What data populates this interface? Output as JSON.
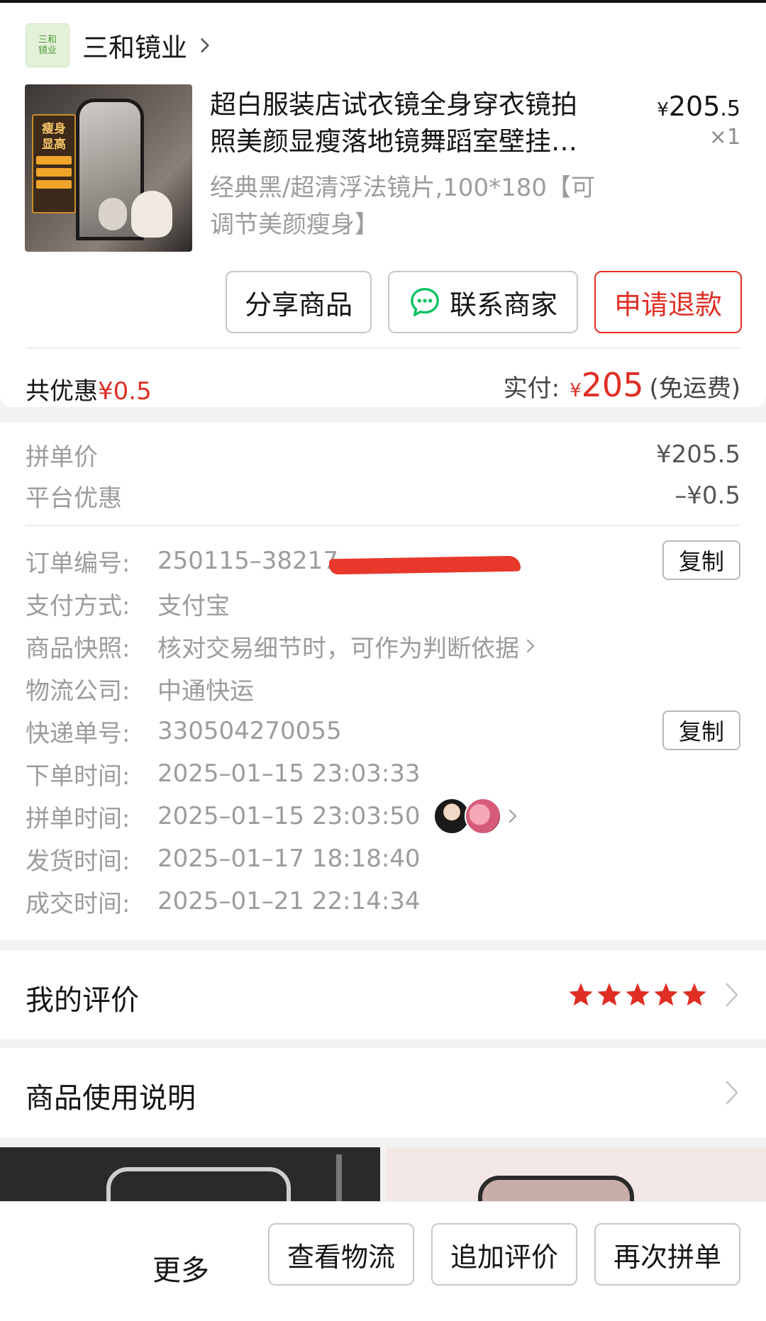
{
  "shop": {
    "name": "三和镜业",
    "logo_text": [
      "三和",
      "镜业"
    ]
  },
  "product": {
    "image_badge": "瘦身显高",
    "title_lines": [
      "超白服装店试衣镜全身穿衣镜拍",
      "照美颜显瘦落地镜舞蹈室壁挂…"
    ],
    "price_yen": "¥",
    "price_int": "205",
    "price_dec": ".5",
    "quantity": "×1",
    "spec_lines": [
      "经典黑/超清浮法镜片,100*180【可",
      "调节美颜瘦身】"
    ]
  },
  "actions": {
    "share": "分享商品",
    "contact": "联系商家",
    "refund": "申请退款"
  },
  "summary": {
    "savings_label": "共优惠",
    "savings_value": "¥0.5",
    "paid_label": "实付:",
    "paid_yen": "¥",
    "paid_amount": "205",
    "shipping": "(免运费)"
  },
  "price_breakdown": {
    "group_price_label": "拼单价",
    "group_price_value": "¥205.5",
    "platform_discount_label": "平台优惠",
    "platform_discount_value": "–¥0.5"
  },
  "order_info": {
    "order_no_label": "订单编号:",
    "order_no_value": "250115–38217",
    "payment_label": "支付方式:",
    "payment_value": "支付宝",
    "snapshot_label": "商品快照:",
    "snapshot_value": "核对交易细节时，可作为判断依据",
    "carrier_label": "物流公司:",
    "carrier_value": "中通快运",
    "tracking_label": "快递单号:",
    "tracking_value": "330504270055",
    "ordered_label": "下单时间:",
    "ordered_value": "2025–01–15 23:03:33",
    "grouped_label": "拼单时间:",
    "grouped_value": "2025–01–15 23:03:50",
    "shipped_label": "发货时间:",
    "shipped_value": "2025–01–17 18:18:40",
    "completed_label": "成交时间:",
    "completed_value": "2025–01–21 22:14:34",
    "copy_label": "复制"
  },
  "review": {
    "title": "我的评价",
    "stars": 5,
    "star_color": "#e02e24"
  },
  "usage": {
    "title": "商品使用说明"
  },
  "bottom_bar": {
    "more": "更多",
    "logistics": "查看物流",
    "add_review": "追加评价",
    "reorder": "再次拼单"
  },
  "colors": {
    "accent_red": "#e02e24",
    "wechat_green": "#07c160"
  }
}
